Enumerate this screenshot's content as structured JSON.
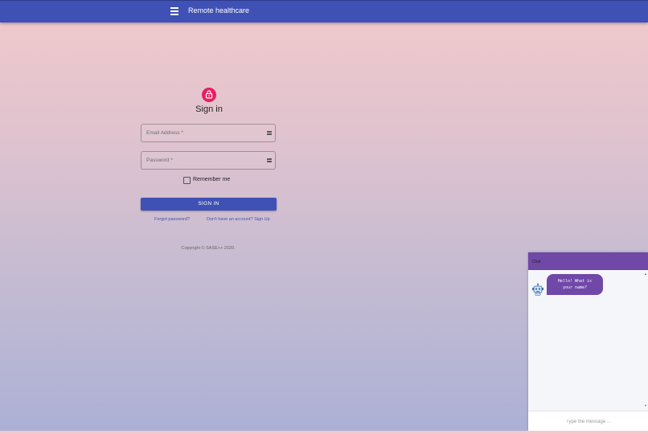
{
  "app_bar": {
    "title": "Remote healthcare",
    "menu_icon": "hamburger-menu-icon",
    "color": "#3f51b5"
  },
  "signin": {
    "avatar_icon": "lock-icon",
    "avatar_color": "#e91e63",
    "title": "Sign in",
    "email_label": "Email Address",
    "password_label": "Password",
    "required_marker": "*",
    "field_icon": "password-manager-icon",
    "remember_label": "Remember me",
    "remember_checked": false,
    "button_label": "SIGN IN",
    "forgot_link": "Forgot password?",
    "signup_link": "Don't have an account? Sign Up",
    "copyright": "Copyright © SASE++ 2020."
  },
  "chat": {
    "title": "Chat",
    "header_color": "#7048a8",
    "bot_avatar_icon": "robot-icon",
    "messages": [
      {
        "from": "bot",
        "line1": "Hello! What is",
        "line2": "your name?"
      }
    ],
    "input_placeholder": "Type the message ..."
  }
}
